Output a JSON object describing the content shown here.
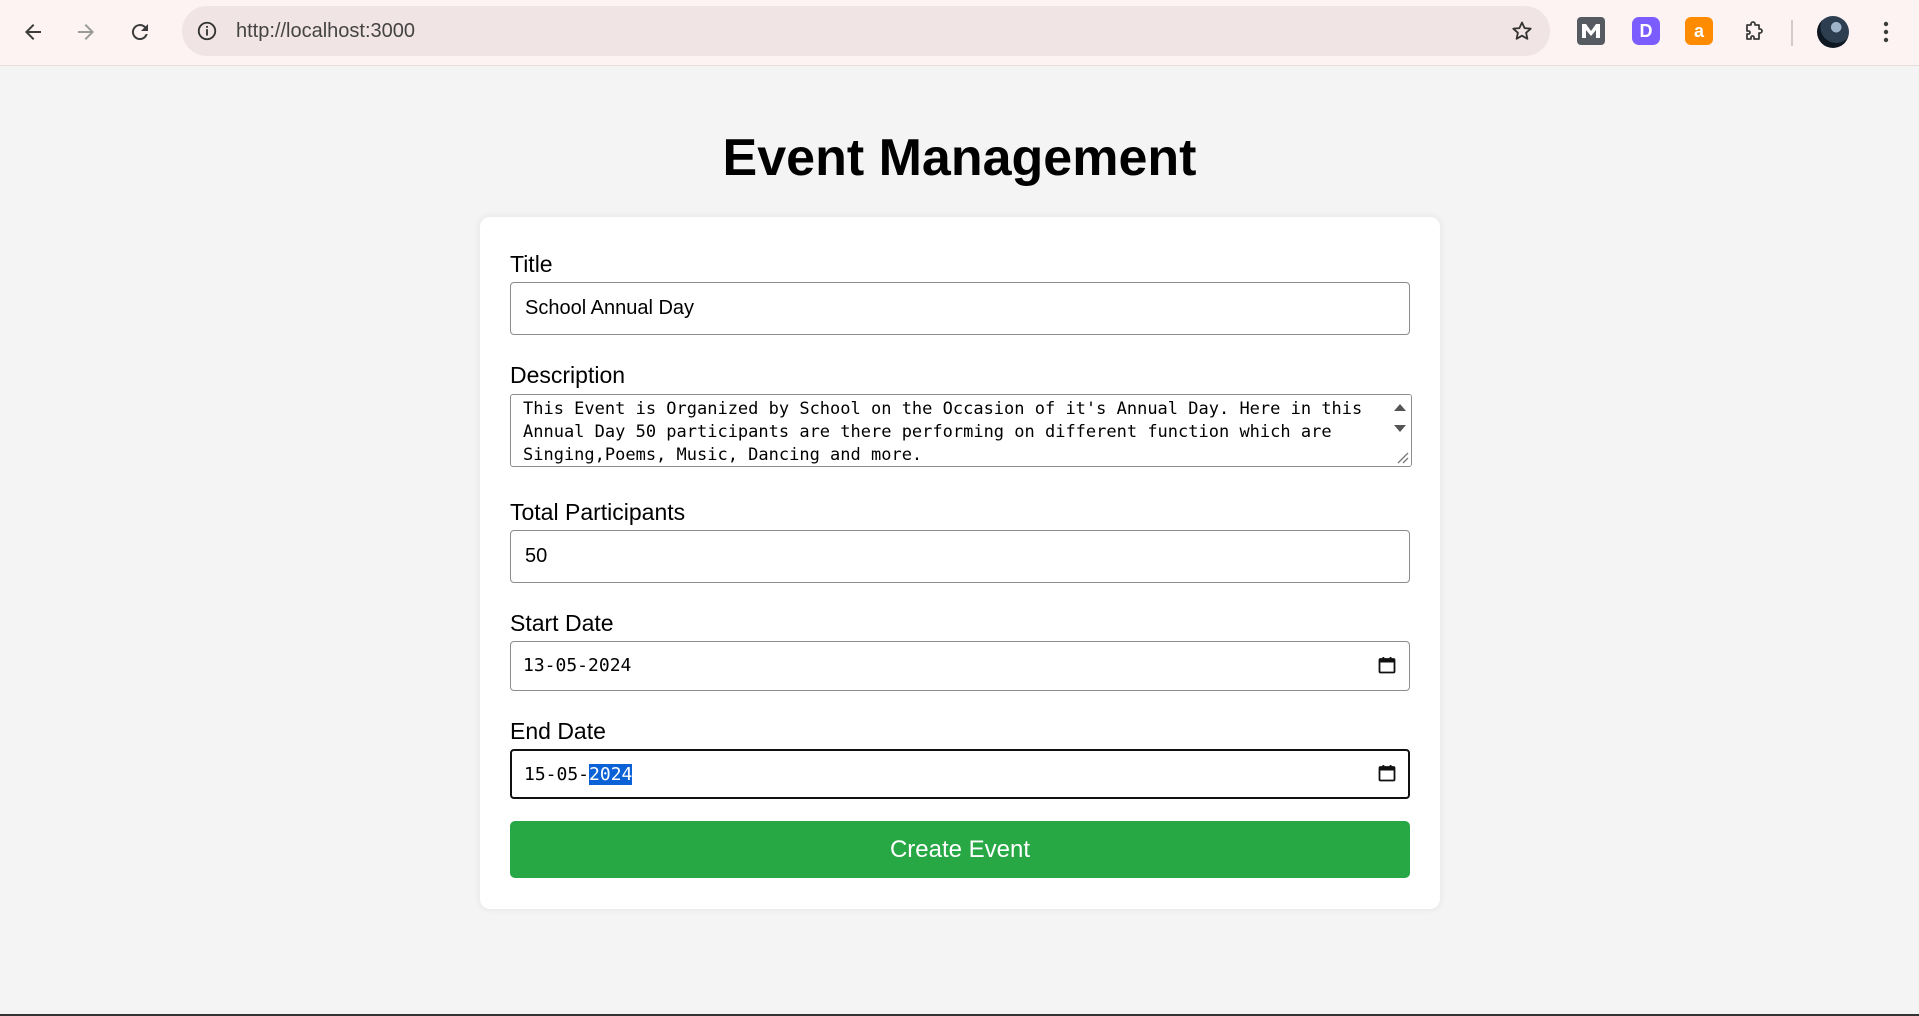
{
  "browser": {
    "url": "http://localhost:3000",
    "extensions": [
      {
        "name": "m-extension-icon",
        "letter": "M",
        "color": "#555b61"
      },
      {
        "name": "d-extension-icon",
        "letter": "D",
        "color": "#7b5cff"
      },
      {
        "name": "a-extension-icon",
        "letter": "a",
        "color": "#ff8c00"
      }
    ]
  },
  "page": {
    "title": "Event Management"
  },
  "form": {
    "title_label": "Title",
    "title_value": "School Annual Day",
    "description_label": "Description",
    "description_value": "This Event is Organized by School on the Occasion of it's Annual Day. Here in this Annual Day 50 participants are there performing on different function which are Singing,Poems, Music, Dancing and more.",
    "participants_label": "Total Participants",
    "participants_value": "50",
    "start_label": "Start Date",
    "start_value": "13-05-2024",
    "end_label": "End Date",
    "end_value_prefix": "15-05-",
    "end_value_selected": "2024",
    "submit_label": "Create Event"
  },
  "colors": {
    "page_bg": "#f4f4f4",
    "submit_bg": "#28a745",
    "selection": "#0b62d6"
  }
}
